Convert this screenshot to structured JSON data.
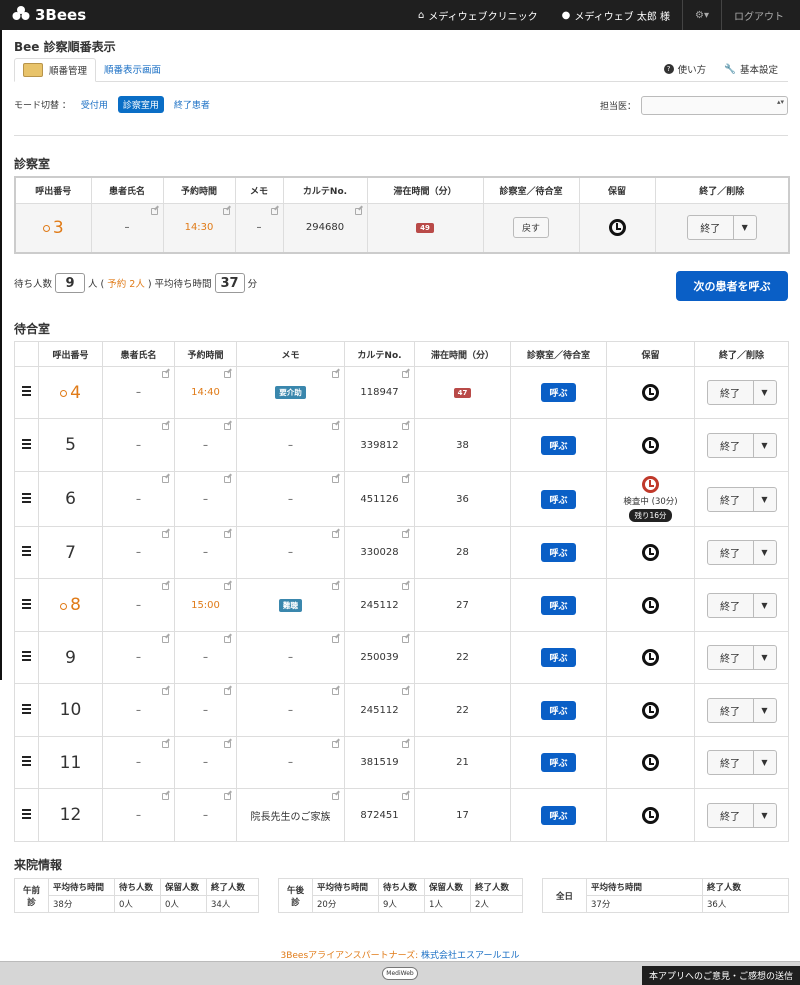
{
  "nav": {
    "brand": "3Bees",
    "clinic": "メディウェブクリニック",
    "user": "メディウェブ 太郎 様",
    "settings": "⚙▾",
    "logout": "ログアウト"
  },
  "title": "Bee 診察順番表示",
  "tabs": {
    "active": "順番管理",
    "display": "順番表示画面",
    "help": "使い方",
    "settings": "基本設定"
  },
  "mode": {
    "label": "モード切替 ：",
    "reception": "受付用",
    "exam": "診察室用",
    "finished": "終了患者"
  },
  "doctor_label": "担当医：",
  "exam_section": "診察室",
  "wait_section": "待合室",
  "headers": [
    "呼出番号",
    "患者氏名",
    "予約時間",
    "メモ",
    "カルテNo.",
    "滞在時間（分）",
    "診察室／待合室",
    "保留",
    "終了／削除"
  ],
  "exam_row": {
    "number": "3",
    "name": "–",
    "time": "14:30",
    "memo": "–",
    "chart": "294680",
    "stay": "49",
    "action": "戻す",
    "end": "終了",
    "caret": "▼"
  },
  "wait_info": {
    "label1": "待ち人数",
    "count": "9",
    "label2": "人 (",
    "reserved": "予約 2人",
    "label3": ") 平均待ち時間",
    "avg": "37",
    "label4": "分"
  },
  "next_button": "次の患者を呼ぶ",
  "call_label": "呼ぶ",
  "end_label": "終了",
  "caret": "▼",
  "waiting": [
    {
      "number": "4",
      "name": "–",
      "time": "14:40",
      "memo": "要介助",
      "chart": "118947",
      "stay": "47"
    },
    {
      "number": "5",
      "name": "–",
      "time": "–",
      "memo": "–",
      "chart": "339812",
      "stay": "38"
    },
    {
      "number": "6",
      "name": "–",
      "time": "–",
      "memo": "–",
      "chart": "451126",
      "stay": "36",
      "hold_text": "検査中 (30分)",
      "remain": "残り16分"
    },
    {
      "number": "7",
      "name": "–",
      "time": "–",
      "memo": "–",
      "chart": "330028",
      "stay": "28"
    },
    {
      "number": "8",
      "name": "–",
      "time": "15:00",
      "memo": "難聴",
      "chart": "245112",
      "stay": "27"
    },
    {
      "number": "9",
      "name": "–",
      "time": "–",
      "memo": "–",
      "chart": "250039",
      "stay": "22"
    },
    {
      "number": "10",
      "name": "–",
      "time": "–",
      "memo": "–",
      "chart": "245112",
      "stay": "22"
    },
    {
      "number": "11",
      "name": "–",
      "time": "–",
      "memo": "–",
      "chart": "381519",
      "stay": "21"
    },
    {
      "number": "12",
      "name": "–",
      "time": "–",
      "memo": "院長先生のご家族",
      "chart": "872451",
      "stay": "17"
    }
  ],
  "visit_section": "来院情報",
  "stats": {
    "am": {
      "label": "午前診",
      "h1": "平均待ち時間",
      "h2": "待ち人数",
      "h3": "保留人数",
      "h4": "終了人数",
      "v1": "38分",
      "v2": "0人",
      "v3": "0人",
      "v4": "34人"
    },
    "pm": {
      "label": "午後診",
      "h1": "平均待ち時間",
      "h2": "待ち人数",
      "h3": "保留人数",
      "h4": "終了人数",
      "v1": "20分",
      "v2": "9人",
      "v3": "1人",
      "v4": "2人"
    },
    "all": {
      "label": "全日",
      "h1": "平均待ち時間",
      "h2": "終了人数",
      "v1": "37分",
      "v2": "36人"
    }
  },
  "footer": {
    "partners": "3Beesアライアンスパートナーズ: ",
    "company": "株式会社エスアールエル",
    "logo": "MediWeb",
    "feedback": "本アプリへのご意見・ご感想の送信"
  }
}
